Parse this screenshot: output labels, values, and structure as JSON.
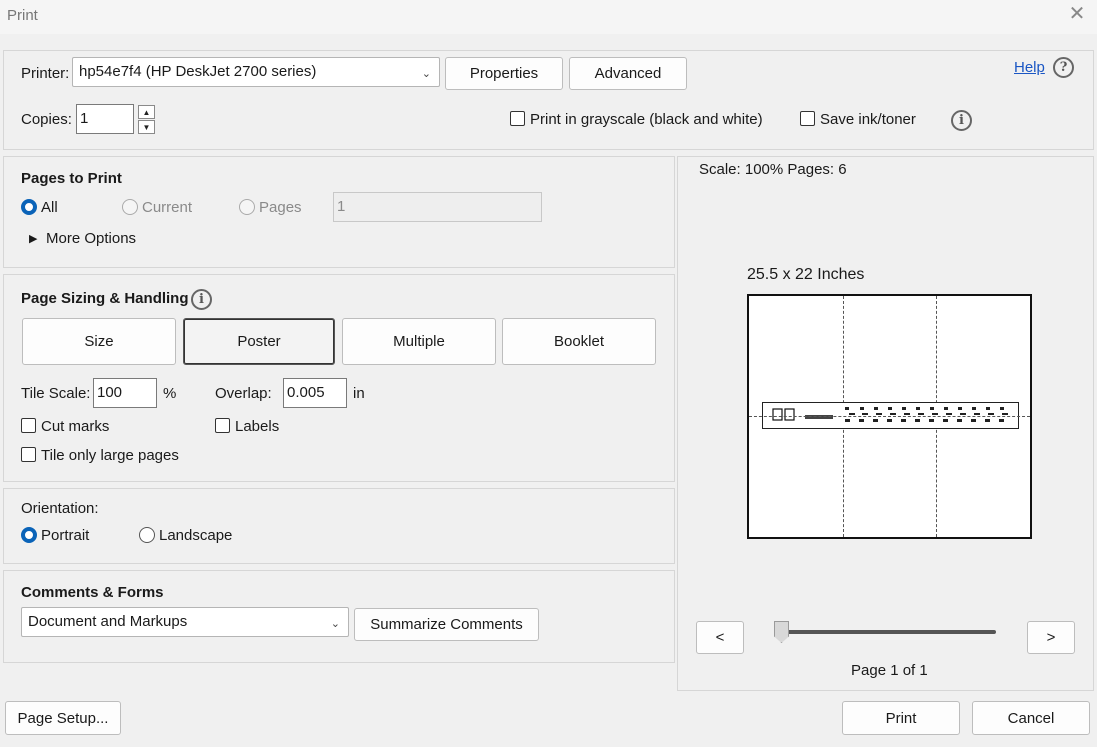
{
  "window": {
    "title": "Print"
  },
  "header": {
    "printer_label": "Printer:",
    "printer_value": "hp54e7f4 (HP DeskJet 2700 series)",
    "properties_label": "Properties",
    "advanced_label": "Advanced",
    "help_label": "Help",
    "copies_label": "Copies:",
    "copies_value": "1",
    "grayscale_label": "Print in grayscale (black and white)",
    "save_ink_label": "Save ink/toner"
  },
  "pages_to_print": {
    "title": "Pages to Print",
    "all_label": "All",
    "current_label": "Current",
    "pages_label": "Pages",
    "pages_value": "1",
    "more_options_label": "More Options"
  },
  "sizing": {
    "title": "Page Sizing & Handling",
    "tabs": [
      "Size",
      "Poster",
      "Multiple",
      "Booklet"
    ],
    "selected_tab": "Poster",
    "tile_scale_label": "Tile Scale:",
    "tile_scale_value": "100",
    "tile_scale_unit": "%",
    "overlap_label": "Overlap:",
    "overlap_value": "0.005",
    "overlap_unit": "in",
    "cut_marks_label": "Cut marks",
    "labels_label": "Labels",
    "tile_large_label": "Tile only large pages"
  },
  "orientation": {
    "title": "Orientation:",
    "portrait_label": "Portrait",
    "landscape_label": "Landscape"
  },
  "comments": {
    "title": "Comments & Forms",
    "select_value": "Document and Markups",
    "summarize_label": "Summarize Comments"
  },
  "preview": {
    "scale_text": "Scale: 100% Pages: 6",
    "size_text": "25.5 x 22 Inches",
    "prev_label": "<",
    "next_label": ">",
    "page_text": "Page 1 of 1"
  },
  "footer": {
    "page_setup_label": "Page Setup...",
    "print_label": "Print",
    "cancel_label": "Cancel"
  },
  "icons": {
    "close": "close-icon",
    "help": "question-circle-icon",
    "info": "info-circle-icon",
    "expand": "triangle-right-icon",
    "dropdown": "chevron-down-icon"
  },
  "colors": {
    "accent": "#0a63b8",
    "link": "#1a56c4"
  }
}
